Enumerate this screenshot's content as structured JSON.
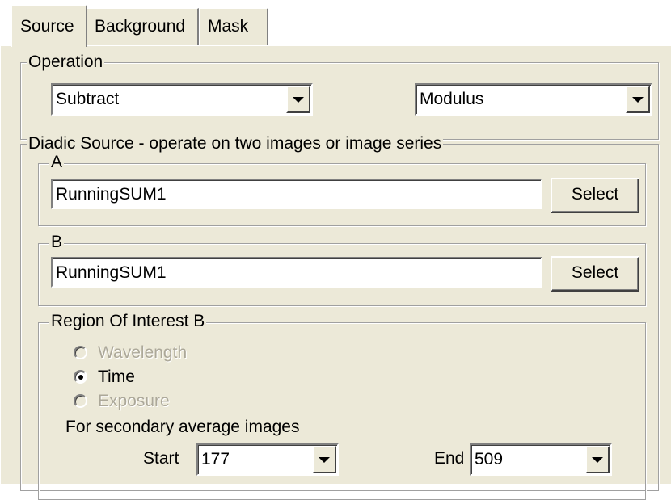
{
  "tabs": [
    {
      "label": "Source"
    },
    {
      "label": "Background"
    },
    {
      "label": "Mask"
    }
  ],
  "operation": {
    "legend": "Operation",
    "op_value": "Subtract",
    "mode_value": "Modulus"
  },
  "diadic": {
    "legend": "Diadic Source - operate on two images or image series",
    "a": {
      "legend": "A",
      "value": "RunningSUM1",
      "select_label": "Select"
    },
    "b": {
      "legend": "B",
      "value": "RunningSUM1",
      "select_label": "Select"
    }
  },
  "roi": {
    "legend": "Region Of Interest B",
    "options": [
      {
        "label": "Wavelength",
        "enabled": false,
        "checked": false
      },
      {
        "label": "Time",
        "enabled": true,
        "checked": true
      },
      {
        "label": "Exposure",
        "enabled": false,
        "checked": false
      }
    ],
    "secondary_label": "For secondary average images",
    "start_label": "Start",
    "start_value": "177",
    "end_label": "End",
    "end_value": "509"
  }
}
